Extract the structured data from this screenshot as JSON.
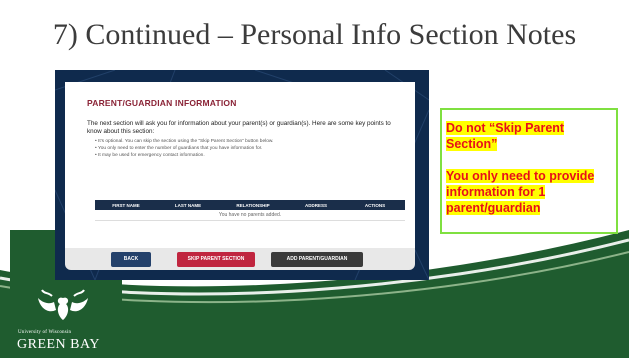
{
  "slide": {
    "title": "7) Continued – Personal Info Section Notes"
  },
  "screenshot": {
    "heading": "PARENT/GUARDIAN INFORMATION",
    "intro": "The next section will ask you for information about your parent(s) or guardian(s). Here are some key points to know about this section:",
    "bullets": [
      "It’s optional. You can skip the section using the “Skip Parent Section” button below.",
      "You only need to enter the number of guardians that you have information for.",
      "It may be used for emergency contact information."
    ],
    "table_headers": [
      "FIRST NAME",
      "LAST NAME",
      "RELATIONSHIP",
      "ADDRESS",
      "ACTIONS"
    ],
    "empty_message": "You have no parents added.",
    "buttons": {
      "back": "BACK",
      "skip": "SKIP PARENT SECTION",
      "add": "ADD PARENT/GUARDIAN"
    }
  },
  "notes": {
    "note1": "Do not “Skip Parent Section”",
    "note2": "You only need to provide information for 1 parent/guardian"
  },
  "logo": {
    "line1": "University of Wisconsin",
    "line2": "GREEN BAY"
  },
  "colors": {
    "footer_green": "#1f5c2f",
    "heading_maroon": "#8a2336",
    "note_red": "#e8101a",
    "note_highlight": "#ffff00",
    "notes_border": "#7fe040"
  }
}
